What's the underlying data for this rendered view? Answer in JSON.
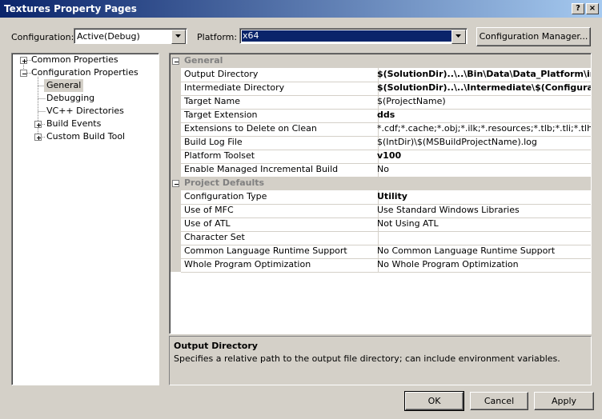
{
  "window": {
    "title": "Textures Property Pages",
    "help_glyph": "?",
    "close_glyph": "×"
  },
  "toolbar": {
    "configuration_label": "Configuration:",
    "configuration_value": "Active(Debug)",
    "platform_label": "Platform:",
    "platform_value": "x64",
    "config_manager_label": "Configuration Manager..."
  },
  "tree": {
    "common_properties": "Common Properties",
    "configuration_properties": "Configuration Properties",
    "general": "General",
    "debugging": "Debugging",
    "vc_directories": "VC++ Directories",
    "build_events": "Build Events",
    "custom_build_tool": "Custom Build Tool"
  },
  "grid": {
    "general_section": "General",
    "general_rows": [
      {
        "name": "Output Directory",
        "value": "$(SolutionDir)..\\..\\Bin\\Data\\Data_Platform\\ima"
      },
      {
        "name": "Intermediate Directory",
        "value": "$(SolutionDir)..\\..\\Intermediate\\$(Configuration"
      },
      {
        "name": "Target Name",
        "value": "$(ProjectName)"
      },
      {
        "name": "Target Extension",
        "value": "dds"
      },
      {
        "name": "Extensions to Delete on Clean",
        "value": "*.cdf;*.cache;*.obj;*.ilk;*.resources;*.tlb;*.tli;*.tlh;*."
      },
      {
        "name": "Build Log File",
        "value": "$(IntDir)\\$(MSBuildProjectName).log"
      },
      {
        "name": "Platform Toolset",
        "value": "v100"
      },
      {
        "name": "Enable Managed Incremental Build",
        "value": "No"
      }
    ],
    "defaults_section": "Project Defaults",
    "defaults_rows": [
      {
        "name": "Configuration Type",
        "value": "Utility"
      },
      {
        "name": "Use of MFC",
        "value": "Use Standard Windows Libraries"
      },
      {
        "name": "Use of ATL",
        "value": "Not Using ATL"
      },
      {
        "name": "Character Set",
        "value": ""
      },
      {
        "name": "Common Language Runtime Support",
        "value": "No Common Language Runtime Support"
      },
      {
        "name": "Whole Program Optimization",
        "value": "No Whole Program Optimization"
      }
    ]
  },
  "description": {
    "title": "Output Directory",
    "text": "Specifies a relative path to the output file directory; can include environment variables."
  },
  "buttons": {
    "ok": "OK",
    "cancel": "Cancel",
    "apply": "Apply"
  },
  "colors": {
    "selection_blue": "#0a246a",
    "face": "#d4d0c8"
  }
}
